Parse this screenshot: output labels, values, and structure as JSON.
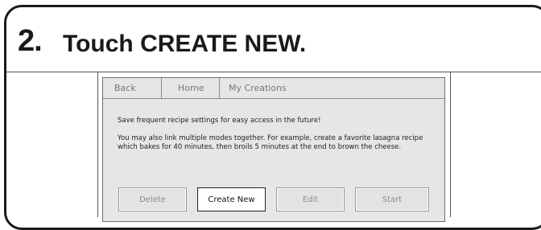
{
  "step": {
    "number": "2.",
    "title": "Touch CREATE NEW."
  },
  "screen": {
    "tabs": [
      {
        "label": "Back"
      },
      {
        "label": "Home"
      },
      {
        "label": "My Creations"
      }
    ],
    "messages": {
      "line1": "Save frequent recipe settings for easy access in the future!",
      "line2": "You may also link multiple modes together.  For example, create a favorite lasagna recipe which bakes for 40 minutes, then broils 5 minutes at the end to brown the cheese."
    },
    "buttons": {
      "delete": "Delete",
      "create_new": "Create New",
      "edit": "Edit",
      "start": "Start"
    }
  }
}
